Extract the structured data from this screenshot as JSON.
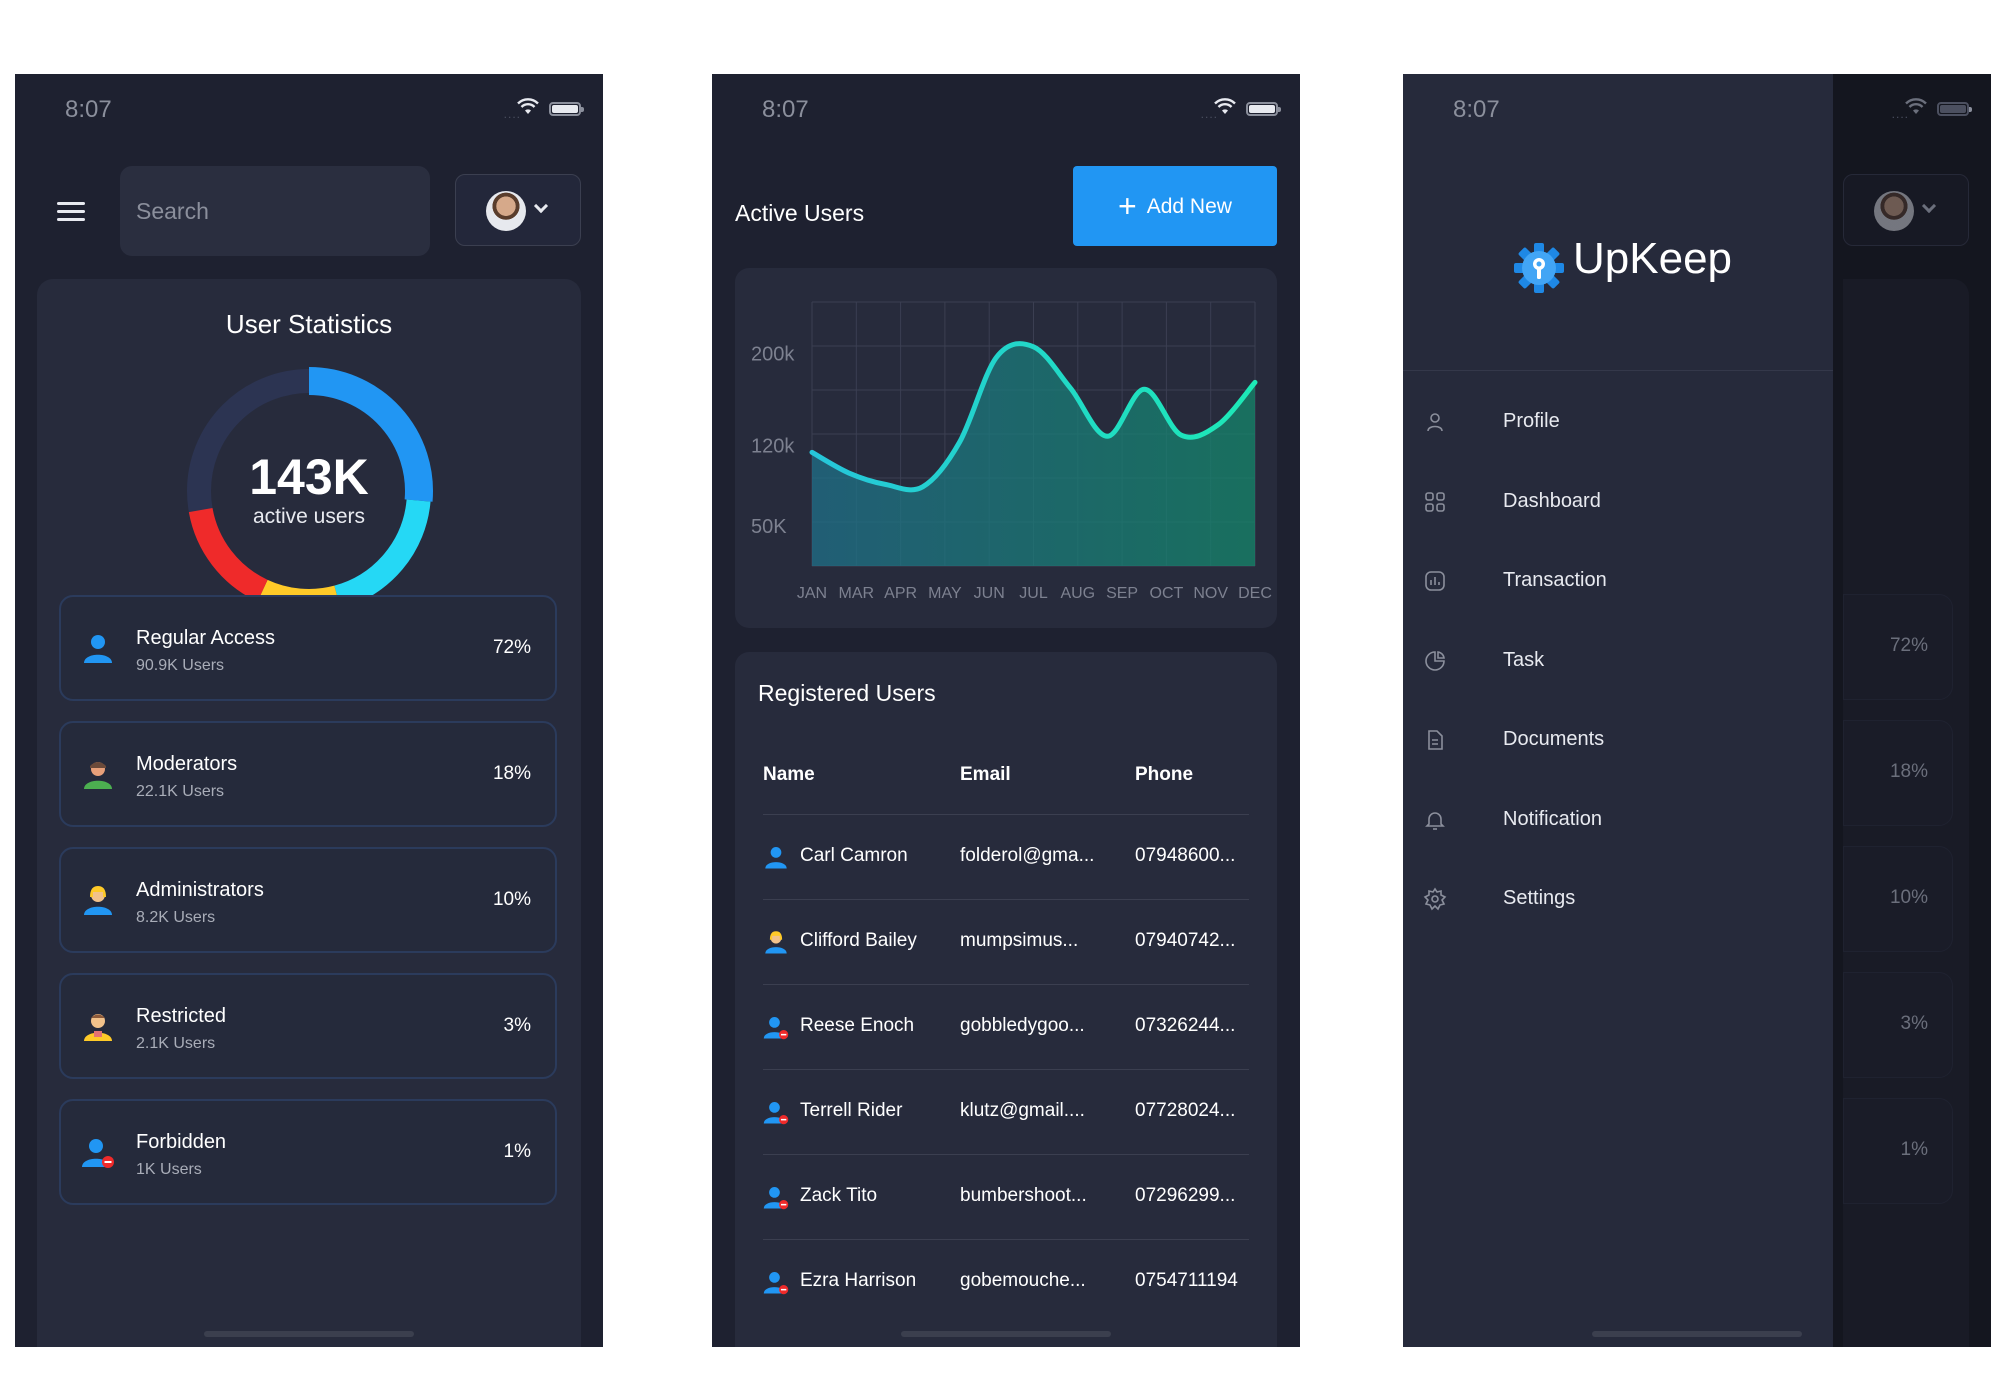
{
  "status": {
    "time": "8:07"
  },
  "screen1": {
    "search_placeholder": "Search",
    "stats_title": "User Statistics",
    "total_value": "143K",
    "total_label": "active users",
    "donut_colors": [
      "#2196f3",
      "#25d8f5",
      "#ffca28",
      "#ef2a2a",
      "#2c3452"
    ],
    "roles": [
      {
        "name": "Regular Access",
        "count": "90.9K Users",
        "pct": "72%",
        "icon": "user-icon"
      },
      {
        "name": "Moderators",
        "count": "22.1K Users",
        "pct": "18%",
        "icon": "moderator-icon"
      },
      {
        "name": "Administrators",
        "count": "8.2K Users",
        "pct": "10%",
        "icon": "admin-icon"
      },
      {
        "name": "Restricted",
        "count": "2.1K Users",
        "pct": "3%",
        "icon": "restricted-user-icon"
      },
      {
        "name": "Forbidden",
        "count": "1K Users",
        "pct": "1%",
        "icon": "forbidden-user-icon"
      }
    ]
  },
  "screen2": {
    "title": "Active Users",
    "add_button": "Add New",
    "chart_data": {
      "type": "area",
      "categories": [
        "JAN",
        "MAR",
        "APR",
        "MAY",
        "JUN",
        "JUL",
        "AUG",
        "SEP",
        "OCT",
        "NOV",
        "DEC"
      ],
      "y_tick_labels": [
        "200k",
        "120k",
        "50K"
      ],
      "y_tick_values": [
        200,
        120,
        50
      ],
      "x_range": [
        0,
        10
      ],
      "ylim": [
        15,
        245
      ],
      "grid": true,
      "line_color_start": "#26c6da",
      "line_color_end": "#1de9b6",
      "values": [
        114,
        96,
        86,
        84,
        123,
        197,
        206,
        170,
        128,
        169,
        129,
        138,
        175
      ]
    },
    "registered_title": "Registered Users",
    "columns": [
      "Name",
      "Email",
      "Phone"
    ],
    "rows": [
      {
        "name": "Carl Camron",
        "email": "folderol@gma...",
        "phone": "07948600...",
        "icon": "user-icon"
      },
      {
        "name": "Clifford Bailey",
        "email": "mumpsimus...",
        "phone": "07940742...",
        "icon": "admin-icon"
      },
      {
        "name": "Reese Enoch",
        "email": "gobbledygoo...",
        "phone": "07326244...",
        "icon": "forbidden-user-icon"
      },
      {
        "name": "Terrell Rider",
        "email": "klutz@gmail....",
        "phone": "07728024...",
        "icon": "forbidden-user-icon"
      },
      {
        "name": "Zack Tito",
        "email": "bumbershoot...",
        "phone": "07296299...",
        "icon": "forbidden-user-icon"
      },
      {
        "name": "Ezra Harrison",
        "email": "gobemouche...",
        "phone": "0754711194",
        "icon": "forbidden-user-icon"
      }
    ]
  },
  "screen3": {
    "logo_text": "UpKeep",
    "nav": [
      {
        "label": "Profile",
        "icon": "profile-icon"
      },
      {
        "label": "Dashboard",
        "icon": "dashboard-icon"
      },
      {
        "label": "Transaction",
        "icon": "transaction-icon"
      },
      {
        "label": "Task",
        "icon": "task-icon"
      },
      {
        "label": "Documents",
        "icon": "documents-icon"
      },
      {
        "label": "Notification",
        "icon": "notification-icon"
      },
      {
        "label": "Settings",
        "icon": "settings-icon"
      }
    ],
    "background_pcts": [
      "72%",
      "18%",
      "10%",
      "3%",
      "1%"
    ]
  }
}
